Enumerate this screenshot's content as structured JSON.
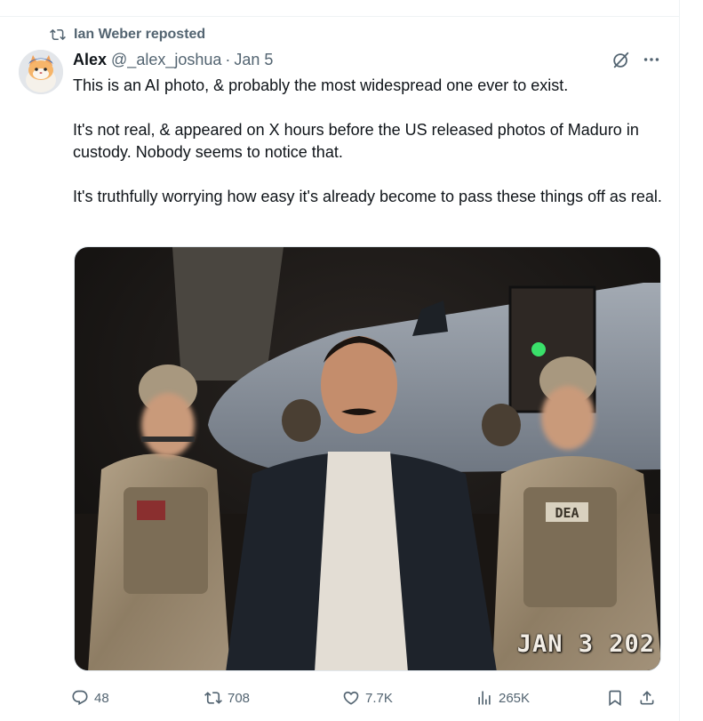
{
  "repost": {
    "label": "Ian Weber reposted"
  },
  "author": {
    "name": "Alex",
    "handle": "@_alex_joshua",
    "separator": "·",
    "date": "Jan 5"
  },
  "tweet": {
    "paragraphs": [
      "This is an AI photo, & probably the most widespread one ever to exist.",
      "It's not real, & appeared on X hours before the US released photos of Maduro in custody. Nobody seems to notice that.",
      "It's truthfully worrying how easy it's already become to pass these things off as real."
    ]
  },
  "media": {
    "date_stamp": "JAN 3 202",
    "vest_patch": "DEA"
  },
  "actions": {
    "replies": "48",
    "reposts": "708",
    "likes": "7.7K",
    "views": "265K"
  },
  "icons": {
    "repost": "repost-icon",
    "avatar": "cat-avatar",
    "grok": "grok-icon",
    "more": "more-icon",
    "reply": "reply-icon",
    "like": "heart-icon",
    "views": "views-icon",
    "bookmark": "bookmark-icon",
    "share": "share-icon"
  },
  "colors": {
    "secondary_text": "#536471",
    "primary_text": "#0f1419",
    "border": "#eff3f4"
  }
}
